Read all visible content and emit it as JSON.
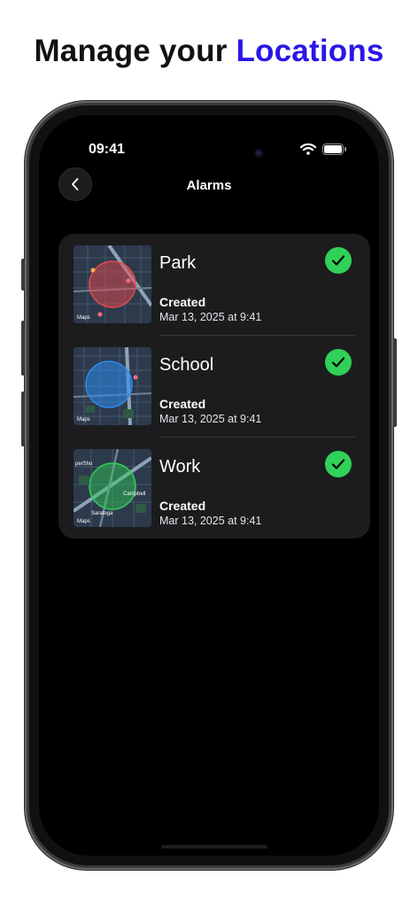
{
  "headline": {
    "prefix": "Manage your",
    "accent": "Locations",
    "accent_color": "#2a17e6"
  },
  "status_bar": {
    "time": "09:41",
    "icons": [
      "wifi-icon",
      "battery-icon"
    ]
  },
  "nav": {
    "title": "Alarms",
    "back_icon": "chevron-left-icon"
  },
  "alarms": [
    {
      "name": "Park",
      "created_label": "Created",
      "date": "Mar 13, 2025 at 9:41",
      "zone_color": "#e5484d",
      "enabled": true,
      "map_labels": {
        "left": "",
        "right": "",
        "bottom": ""
      }
    },
    {
      "name": "School",
      "created_label": "Created",
      "date": "Mar 13, 2025 at 9:41",
      "zone_color": "#2d8cf0",
      "enabled": true,
      "map_labels": {
        "left": "",
        "right": "",
        "bottom": ""
      }
    },
    {
      "name": "Work",
      "created_label": "Created",
      "date": "Mar 13, 2025 at 9:41",
      "zone_color": "#30d158",
      "enabled": true,
      "map_labels": {
        "left": "perSho",
        "right": "Campbell",
        "bottom": "Saratoga"
      }
    }
  ],
  "map_attribution": "Maps",
  "colors": {
    "check": "#30d158",
    "card": "#1c1c1e",
    "background": "#000000"
  }
}
